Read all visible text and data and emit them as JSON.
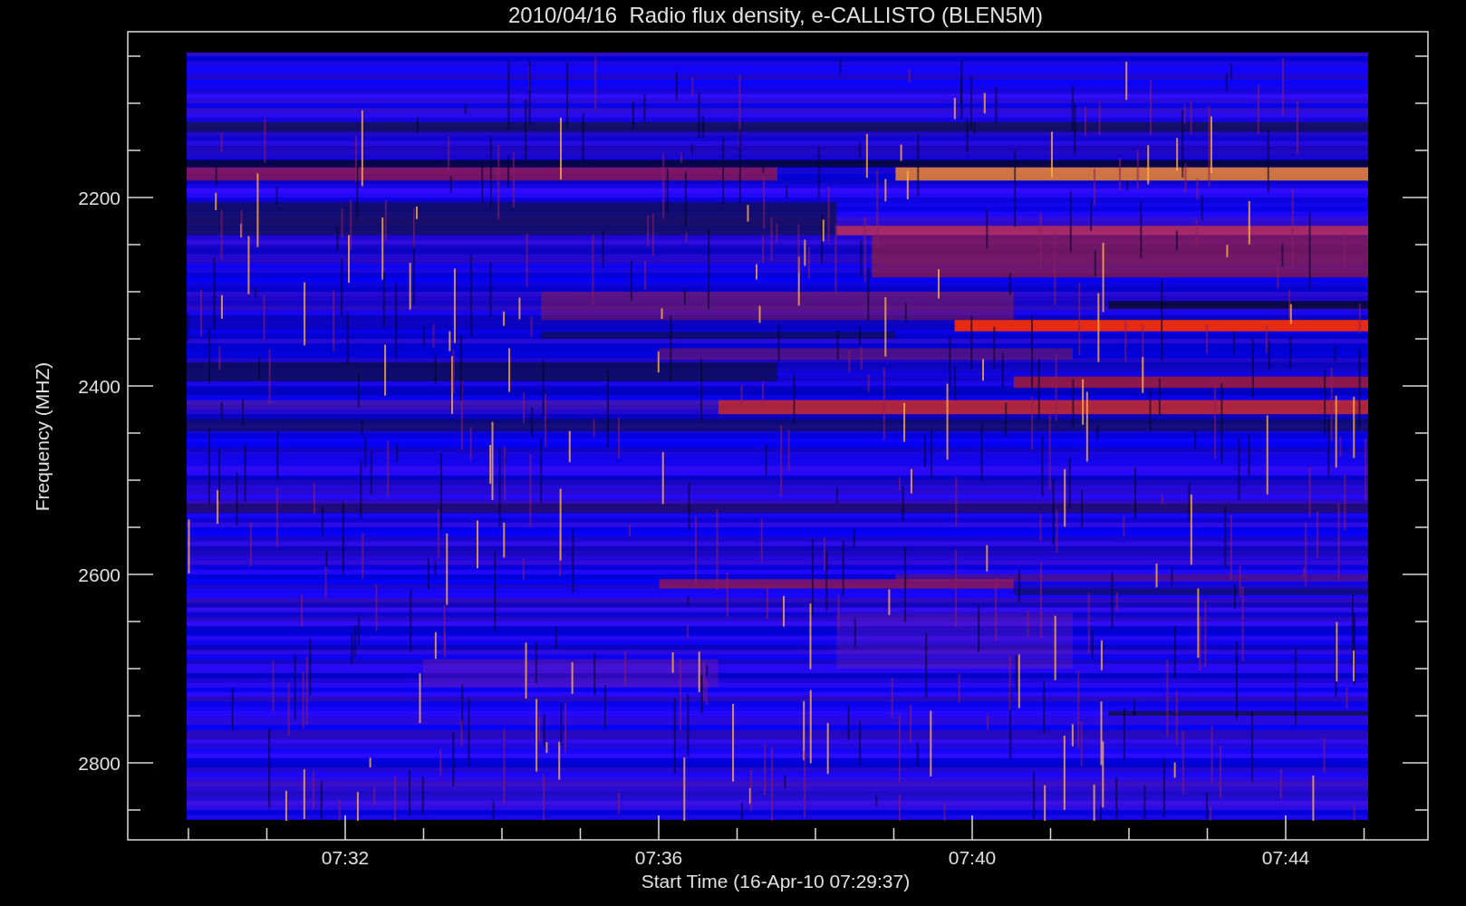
{
  "plot": {
    "title": "2010/04/16  Radio flux density, e-CALLISTO (BLEN5M)",
    "xlabel": "Start Time (16-Apr-10 07:29:37)",
    "ylabel": "Frequency (MHZ)",
    "xticks": [
      "07:32",
      "07:36",
      "07:40",
      "07:44"
    ],
    "yticks": [
      "2200",
      "2400",
      "2600",
      "2800"
    ]
  }
}
